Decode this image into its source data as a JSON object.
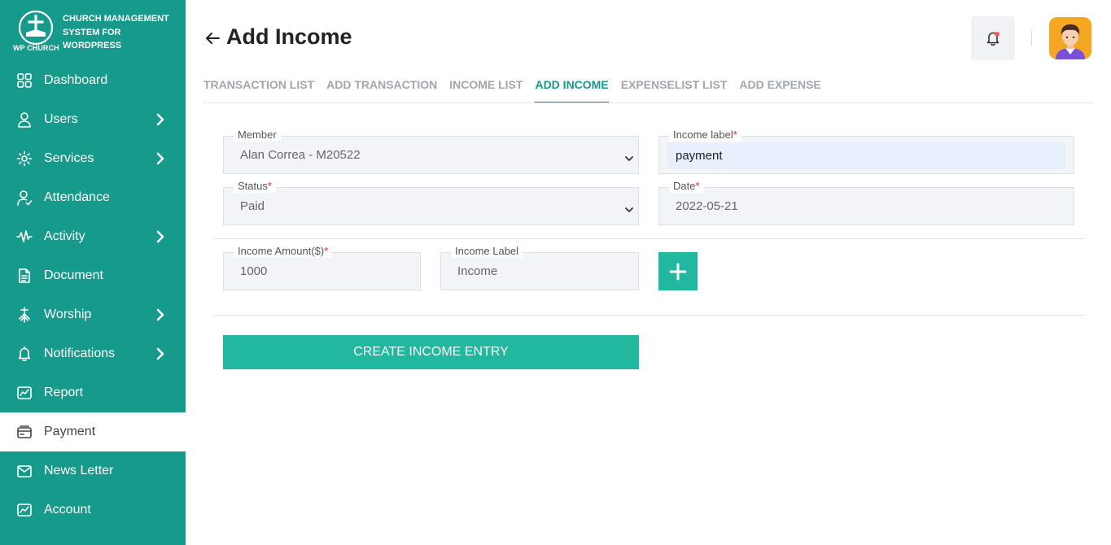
{
  "brand": {
    "name": "CHURCH MANAGEMENT SYSTEM FOR WORDPRESS",
    "logo_text": "WP CHURCH"
  },
  "sidebar": {
    "items": [
      {
        "label": "Dashboard",
        "icon": "dashboard-grid-icon",
        "has_submenu": false
      },
      {
        "label": "Users",
        "icon": "user-icon",
        "has_submenu": true
      },
      {
        "label": "Services",
        "icon": "services-icon",
        "has_submenu": true
      },
      {
        "label": "Attendance",
        "icon": "attendance-icon",
        "has_submenu": false
      },
      {
        "label": "Activity",
        "icon": "activity-icon",
        "has_submenu": true
      },
      {
        "label": "Document",
        "icon": "document-icon",
        "has_submenu": false
      },
      {
        "label": "Worship",
        "icon": "worship-icon",
        "has_submenu": true
      },
      {
        "label": "Notifications",
        "icon": "bell-icon",
        "has_submenu": true
      },
      {
        "label": "Report",
        "icon": "report-icon",
        "has_submenu": false
      },
      {
        "label": "Payment",
        "icon": "payment-icon",
        "has_submenu": false,
        "active": true
      },
      {
        "label": "News Letter",
        "icon": "newsletter-icon",
        "has_submenu": false
      },
      {
        "label": "Account",
        "icon": "account-icon",
        "has_submenu": false
      }
    ]
  },
  "header": {
    "title": "Add Income"
  },
  "tabs": [
    {
      "label": "TRANSACTION LIST"
    },
    {
      "label": "ADD TRANSACTION"
    },
    {
      "label": "INCOME LIST"
    },
    {
      "label": "ADD INCOME",
      "active": true
    },
    {
      "label": "EXPENSELIST LIST"
    },
    {
      "label": "ADD EXPENSE"
    }
  ],
  "form": {
    "member": {
      "label": "Member",
      "value": "Alan Correa - M20522"
    },
    "income_label": {
      "label": "Income label",
      "value": "payment"
    },
    "status": {
      "label": "Status",
      "value": "Paid"
    },
    "date": {
      "label": "Date",
      "value": "2022-05-21"
    },
    "amount": {
      "label": "Income Amount($)",
      "value": "1000"
    },
    "entry_label": {
      "label": "Income Label",
      "value": "Income"
    },
    "required_mark": "*",
    "submit_label": "CREATE INCOME ENTRY"
  },
  "colors": {
    "sidebar_bg": "#159a8c",
    "accent": "#22b8a0",
    "required": "#e0253f",
    "notification_dot": "#f25c54"
  }
}
